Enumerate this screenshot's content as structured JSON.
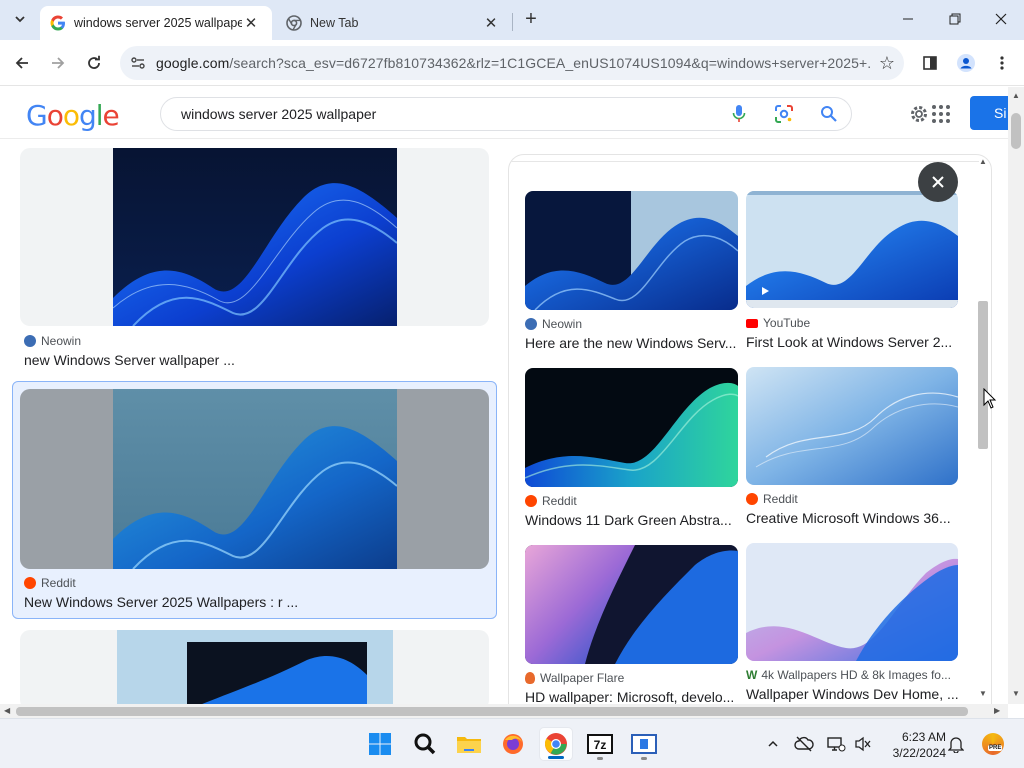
{
  "browser": {
    "tabs": [
      {
        "title": "windows server 2025 wallpaper",
        "active": true
      },
      {
        "title": "New Tab",
        "active": false
      }
    ],
    "url_host": "google.com",
    "url_path": "/search?sca_esv=d6727fb810734362&rlz=1C1GCEA_enUS1074US1094&q=windows+server+2025+..."
  },
  "google": {
    "logo": "Google",
    "query": "windows server 2025 wallpaper",
    "signin_label": "Si"
  },
  "left_results": [
    {
      "source": "Neowin",
      "caption": "new Windows Server wallpaper ...",
      "source_color": "#3c6db4"
    },
    {
      "source": "Reddit",
      "caption": "New Windows Server 2025 Wallpapers : r ...",
      "source_color": "#ff4500"
    },
    {
      "source": "",
      "caption": ""
    }
  ],
  "panel_results": [
    {
      "source": "Neowin",
      "caption": "Here are the new Windows Serv...",
      "source_color": "#3c6db4"
    },
    {
      "source": "YouTube",
      "caption": "First Look at Windows Server 2...",
      "source_color": "#ff0000"
    },
    {
      "source": "Reddit",
      "caption": "Windows 11 Dark Green Abstra...",
      "source_color": "#ff4500"
    },
    {
      "source": "Reddit",
      "caption": "Creative Microsoft Windows 36...",
      "source_color": "#ff4500"
    },
    {
      "source": "Wallpaper Flare",
      "caption": "HD wallpaper: Microsoft, develo...",
      "source_color": "#e8692c"
    },
    {
      "source": "4k Wallpapers HD & 8k Images fo...",
      "caption": "Wallpaper Windows Dev Home, ...",
      "source_color": "#2e7d32"
    }
  ],
  "taskbar": {
    "time": "6:23 AM",
    "date": "3/22/2024",
    "apps": [
      "start-icon",
      "search-icon",
      "file-explorer-icon",
      "firefox-icon",
      "chrome-icon",
      "7zip-icon",
      "window-app-icon"
    ],
    "pre_badge": "PRE"
  }
}
